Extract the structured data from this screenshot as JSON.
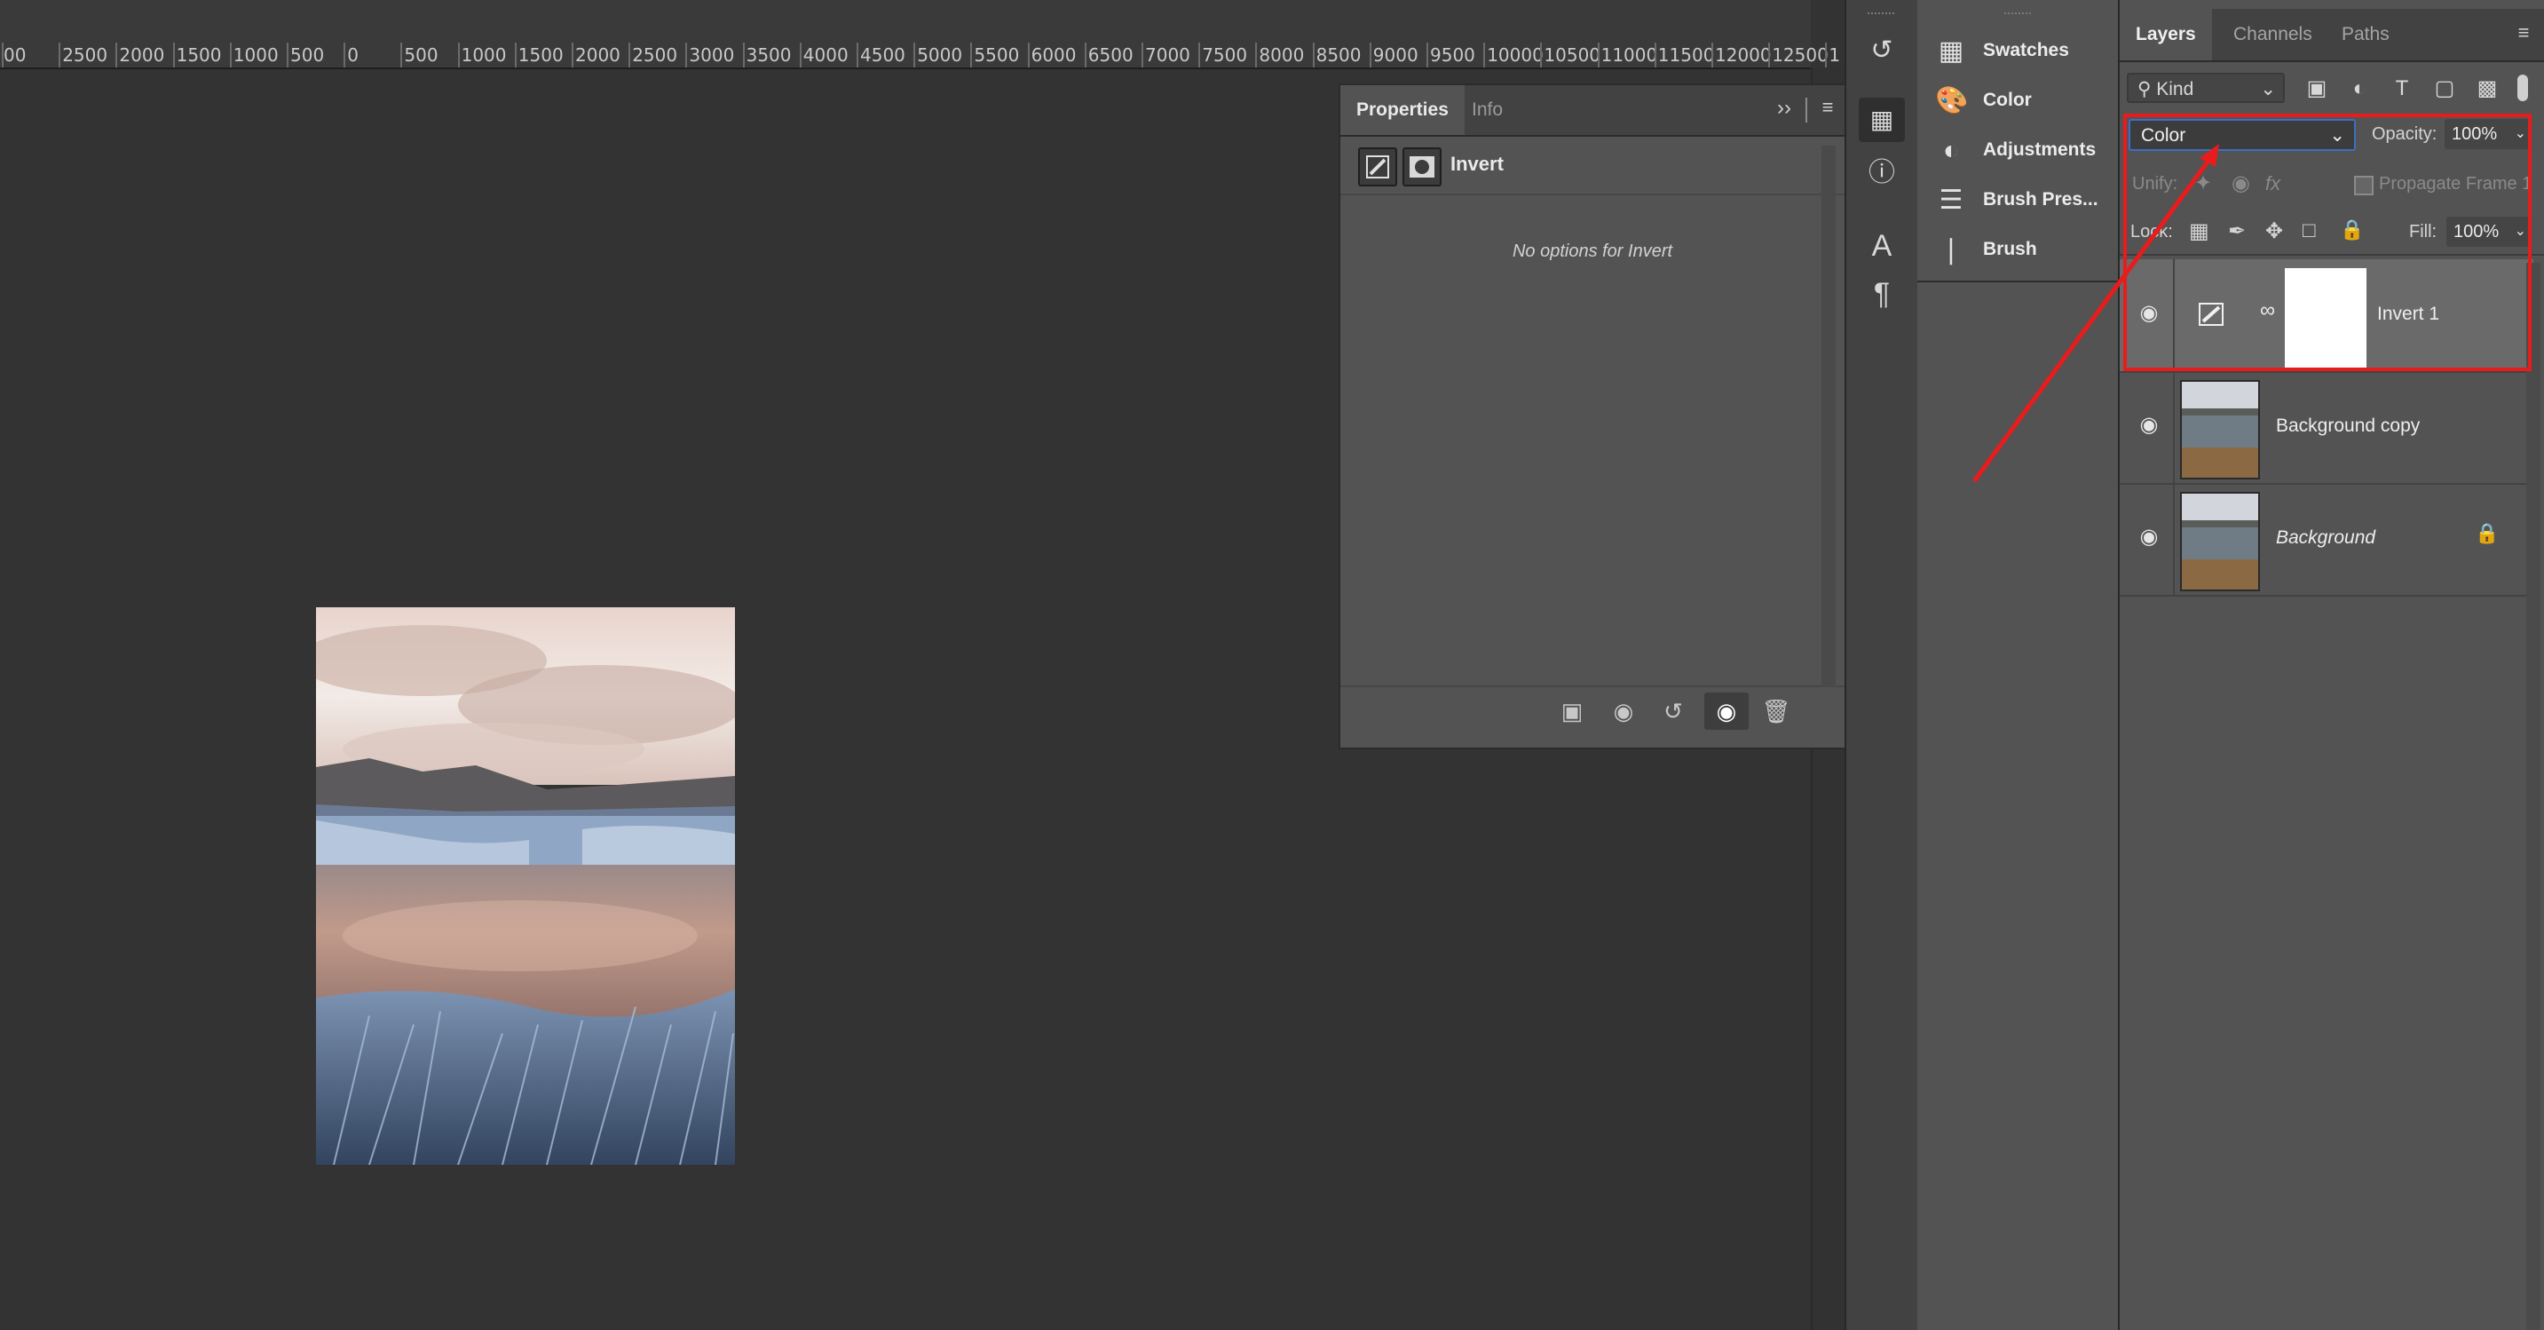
{
  "ruler": {
    "labels": [
      "00",
      "2500",
      "2000",
      "1500",
      "1000",
      "500",
      "0",
      "500",
      "1000",
      "1500",
      "2000",
      "2500",
      "3000",
      "3500",
      "4000",
      "4500",
      "5000",
      "5500",
      "6000",
      "6500",
      "7000",
      "7500",
      "8000",
      "8500",
      "9000",
      "9500",
      "10000",
      "10500",
      "11000",
      "11500",
      "12000",
      "12500",
      "1"
    ]
  },
  "properties": {
    "tabs": [
      "Properties",
      "Info"
    ],
    "expand_icon": "double-chevron-icon",
    "menu_icon": "hamburger-icon",
    "title": "Invert",
    "message": "No options for Invert",
    "footer_icons": [
      "clip-to-layer-icon",
      "view-previous-state-icon",
      "reset-icon",
      "visibility-eye-icon",
      "delete-icon"
    ]
  },
  "dock": {
    "icons": [
      "history-icon",
      "properties-icon",
      "info-icon",
      "character-icon",
      "paragraph-icon"
    ]
  },
  "panel_list": {
    "items": [
      {
        "label": "Swatches",
        "icon": "grid-icon"
      },
      {
        "label": "Color",
        "icon": "palette-icon"
      },
      {
        "label": "Adjustments",
        "icon": "adjustments-icon"
      },
      {
        "label": "Brush Pres...",
        "icon": "brush-presets-icon"
      },
      {
        "label": "Brush",
        "icon": "brush-icon"
      }
    ]
  },
  "layers": {
    "tabs": [
      "Layers",
      "Channels",
      "Paths"
    ],
    "kind_label": "Kind",
    "blend_mode": "Color",
    "opacity_label": "Opacity:",
    "opacity_value": "100%",
    "unify_label": "Unify:",
    "propagate_label": "Propagate Frame 1",
    "lock_label": "Lock:",
    "fill_label": "Fill:",
    "fill_value": "100%",
    "rows": [
      {
        "name": "Invert 1",
        "selected": true
      },
      {
        "name": "Background copy",
        "selected": false
      },
      {
        "name": "Background",
        "selected": false,
        "locked": true
      }
    ]
  },
  "colors": {
    "annotation": "#e81c1c",
    "blend_select_border": "#3d6ec4"
  }
}
